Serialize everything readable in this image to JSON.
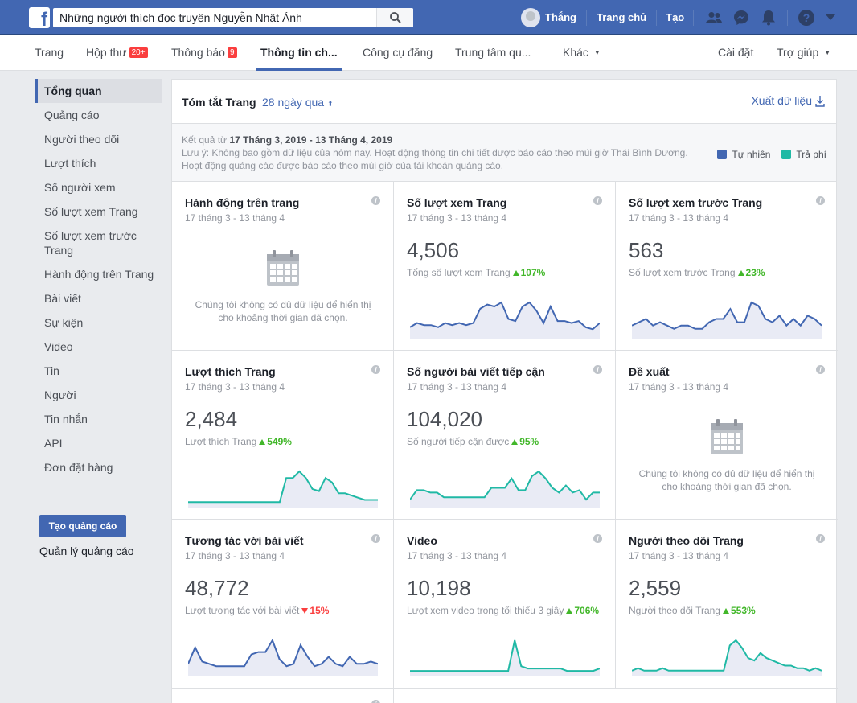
{
  "topbar": {
    "search_value": "Những người thích đọc truyện Nguyễn Nhật Ánh",
    "user_name": "Thắng",
    "home_label": "Trang chủ",
    "create_label": "Tạo"
  },
  "pagenav": {
    "page": "Trang",
    "inbox": "Hộp thư",
    "inbox_badge": "20+",
    "notifications": "Thông báo",
    "notifications_badge": "9",
    "insights": "Thông tin ch...",
    "publishing_tools": "Công cụ đăng",
    "ad_center": "Trung tâm qu...",
    "more": "Khác",
    "settings": "Cài đặt",
    "help": "Trợ giúp"
  },
  "sidebar": {
    "items": [
      {
        "label": "Tổng quan"
      },
      {
        "label": "Quảng cáo"
      },
      {
        "label": "Người theo dõi"
      },
      {
        "label": "Lượt thích"
      },
      {
        "label": "Số người xem"
      },
      {
        "label": "Số lượt xem Trang"
      },
      {
        "label": "Số lượt xem trước Trang"
      },
      {
        "label": "Hành động trên Trang"
      },
      {
        "label": "Bài viết"
      },
      {
        "label": "Sự kiện"
      },
      {
        "label": "Video"
      },
      {
        "label": "Tin"
      },
      {
        "label": "Người"
      },
      {
        "label": "Tin nhắn"
      },
      {
        "label": "API"
      },
      {
        "label": "Đơn đặt hàng"
      }
    ],
    "create_ad": "Tạo quảng cáo",
    "manage_ads": "Quản lý quảng cáo"
  },
  "summary": {
    "title": "Tóm tắt Trang",
    "range": "28 ngày qua",
    "export": "Xuất dữ liệu",
    "results_prefix": "Kết quả từ ",
    "results_dates": "17 Tháng 3, 2019 - 13 Tháng 4, 2019",
    "note_line1": "Lưu ý: Không bao gồm dữ liệu của hôm nay. Hoạt động thông tin chi tiết được báo cáo theo múi giờ Thái Bình Dương.",
    "note_line2": "Hoạt động quảng cáo được báo cáo theo múi giờ của tài khoản quảng cáo.",
    "legend_organic": "Tự nhiên",
    "legend_paid": "Trả phí",
    "organic_color": "#4267b2",
    "paid_color": "#20b9a5"
  },
  "no_data_line1": "Chúng tôi không có đủ dữ liệu để hiển thị",
  "no_data_line2": "cho khoảng thời gian đã chọn.",
  "cards": [
    {
      "title": "Hành động trên trang",
      "date": "17 tháng 3 - 13 tháng 4"
    },
    {
      "title": "Số lượt xem Trang",
      "date": "17 tháng 3 - 13 tháng 4",
      "value": "4,506",
      "sub": "Tổng số lượt xem Trang",
      "change": "107%"
    },
    {
      "title": "Số lượt xem trước Trang",
      "date": "17 tháng 3 - 13 tháng 4",
      "value": "563",
      "sub": "Số lượt xem trước Trang",
      "change": "23%"
    },
    {
      "title": "Lượt thích Trang",
      "date": "17 tháng 3 - 13 tháng 4",
      "value": "2,484",
      "sub": "Lượt thích Trang",
      "change": "549%"
    },
    {
      "title": "Số người bài viết tiếp cận",
      "date": "17 tháng 3 - 13 tháng 4",
      "value": "104,020",
      "sub": "Số người tiếp cận được",
      "change": "95%"
    },
    {
      "title": "Đề xuất",
      "date": "17 tháng 3 - 13 tháng 4"
    },
    {
      "title": "Tương tác với bài viết",
      "date": "17 tháng 3 - 13 tháng 4",
      "value": "48,772",
      "sub": "Lượt tương tác với bài viết",
      "change": "15%"
    },
    {
      "title": "Video",
      "date": "17 tháng 3 - 13 tháng 4",
      "value": "10,198",
      "sub": "Lượt xem video trong tối thiểu 3 giây",
      "change": "706%"
    },
    {
      "title": "Người theo dõi Trang",
      "date": "17 tháng 3 - 13 tháng 4",
      "value": "2,559",
      "sub": "Người theo dõi Trang",
      "change": "553%"
    }
  ],
  "chart_data": [
    {
      "type": "area",
      "name": "page_views",
      "values": [
        4,
        6,
        5,
        5,
        4,
        6,
        5,
        6,
        5,
        6,
        13,
        15,
        14,
        16,
        8,
        7,
        14,
        16,
        12,
        6,
        14,
        7,
        7,
        6,
        7,
        4,
        3,
        6
      ]
    },
    {
      "type": "area",
      "name": "page_previews",
      "values": [
        3,
        4,
        5,
        3,
        4,
        3,
        2,
        3,
        3,
        2,
        2,
        4,
        5,
        5,
        8,
        4,
        4,
        10,
        9,
        5,
        4,
        6,
        3,
        5,
        3,
        6,
        5,
        3
      ]
    },
    {
      "type": "area",
      "name": "page_likes",
      "values": [
        1,
        1,
        1,
        1,
        1,
        1,
        1,
        1,
        1,
        1,
        1,
        1,
        1,
        1,
        1,
        12,
        12,
        15,
        12,
        7,
        6,
        12,
        10,
        5,
        5,
        4,
        3,
        2,
        2,
        2
      ]
    },
    {
      "type": "area",
      "name": "post_reach",
      "values": [
        2,
        6,
        6,
        5,
        5,
        3,
        3,
        3,
        3,
        3,
        3,
        3,
        7,
        7,
        7,
        11,
        6,
        6,
        12,
        14,
        11,
        7,
        5,
        8,
        5,
        6,
        2,
        5,
        5
      ]
    },
    {
      "type": "area",
      "name": "post_engagement",
      "values": [
        4,
        11,
        5,
        4,
        3,
        3,
        3,
        3,
        3,
        8,
        9,
        9,
        14,
        6,
        3,
        4,
        12,
        7,
        3,
        4,
        7,
        4,
        3,
        7,
        4,
        4,
        5,
        4
      ]
    },
    {
      "type": "area",
      "name": "videos",
      "values": [
        1,
        1,
        1,
        1,
        1,
        1,
        1,
        1,
        1,
        1,
        1,
        1,
        1,
        1,
        1,
        1,
        14,
        3,
        2,
        2,
        2,
        2,
        2,
        2,
        1,
        1,
        1,
        1,
        1,
        2
      ]
    },
    {
      "type": "area",
      "name": "page_followers",
      "values": [
        1,
        2,
        1,
        1,
        1,
        2,
        1,
        1,
        1,
        1,
        1,
        1,
        1,
        1,
        1,
        1,
        11,
        13,
        10,
        6,
        5,
        8,
        6,
        5,
        4,
        3,
        3,
        2,
        2,
        1,
        2,
        1
      ]
    }
  ]
}
